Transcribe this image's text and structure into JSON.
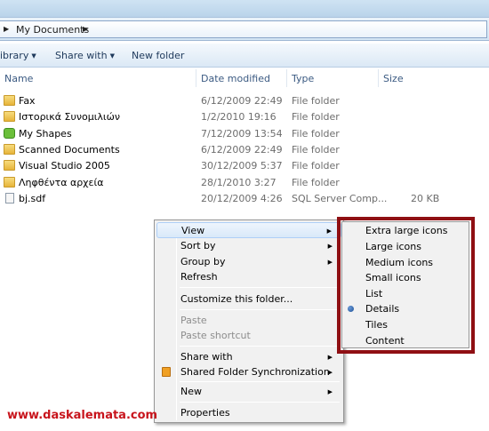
{
  "address_bar": {
    "path_label": "My Documents"
  },
  "toolbar": {
    "library_label": "ibrary",
    "share_label": "Share with",
    "new_folder_label": "New folder"
  },
  "columns": {
    "name": "Name",
    "date": "Date modified",
    "type": "Type",
    "size": "Size"
  },
  "files": [
    {
      "name": "Fax",
      "date": "6/12/2009 22:49",
      "type": "File folder",
      "size": "",
      "icon": "folder-icon"
    },
    {
      "name": "Ιστορικά Συνομιλιών",
      "date": "1/2/2010 19:16",
      "type": "File folder",
      "size": "",
      "icon": "folder-icon"
    },
    {
      "name": "My Shapes",
      "date": "7/12/2009 13:54",
      "type": "File folder",
      "size": "",
      "icon": "shapes-folder-icon"
    },
    {
      "name": "Scanned Documents",
      "date": "6/12/2009 22:49",
      "type": "File folder",
      "size": "",
      "icon": "folder-icon"
    },
    {
      "name": "Visual Studio 2005",
      "date": "30/12/2009 5:37",
      "type": "File folder",
      "size": "",
      "icon": "folder-icon"
    },
    {
      "name": "Ληφθέντα αρχεία",
      "date": "28/1/2010 3:27",
      "type": "File folder",
      "size": "",
      "icon": "folder-icon"
    },
    {
      "name": "bj.sdf",
      "date": "20/12/2009 4:26",
      "type": "SQL Server Comp...",
      "size": "20 KB",
      "icon": "file-icon"
    }
  ],
  "context_menu": {
    "view": "View",
    "sort_by": "Sort by",
    "group_by": "Group by",
    "refresh": "Refresh",
    "customize": "Customize this folder...",
    "paste": "Paste",
    "paste_shortcut": "Paste shortcut",
    "share_with": "Share with",
    "shared_sync": "Shared Folder Synchronization",
    "new": "New",
    "properties": "Properties"
  },
  "view_submenu": {
    "items": [
      "Extra large icons",
      "Large icons",
      "Medium icons",
      "Small icons",
      "List",
      "Details",
      "Tiles",
      "Content"
    ],
    "selected": "Details"
  },
  "watermark": "www.daskalemata.com",
  "colors": {
    "highlight_box": "#8f0f13",
    "watermark": "#c8141c",
    "menu_hover": "#d9e9f9"
  }
}
